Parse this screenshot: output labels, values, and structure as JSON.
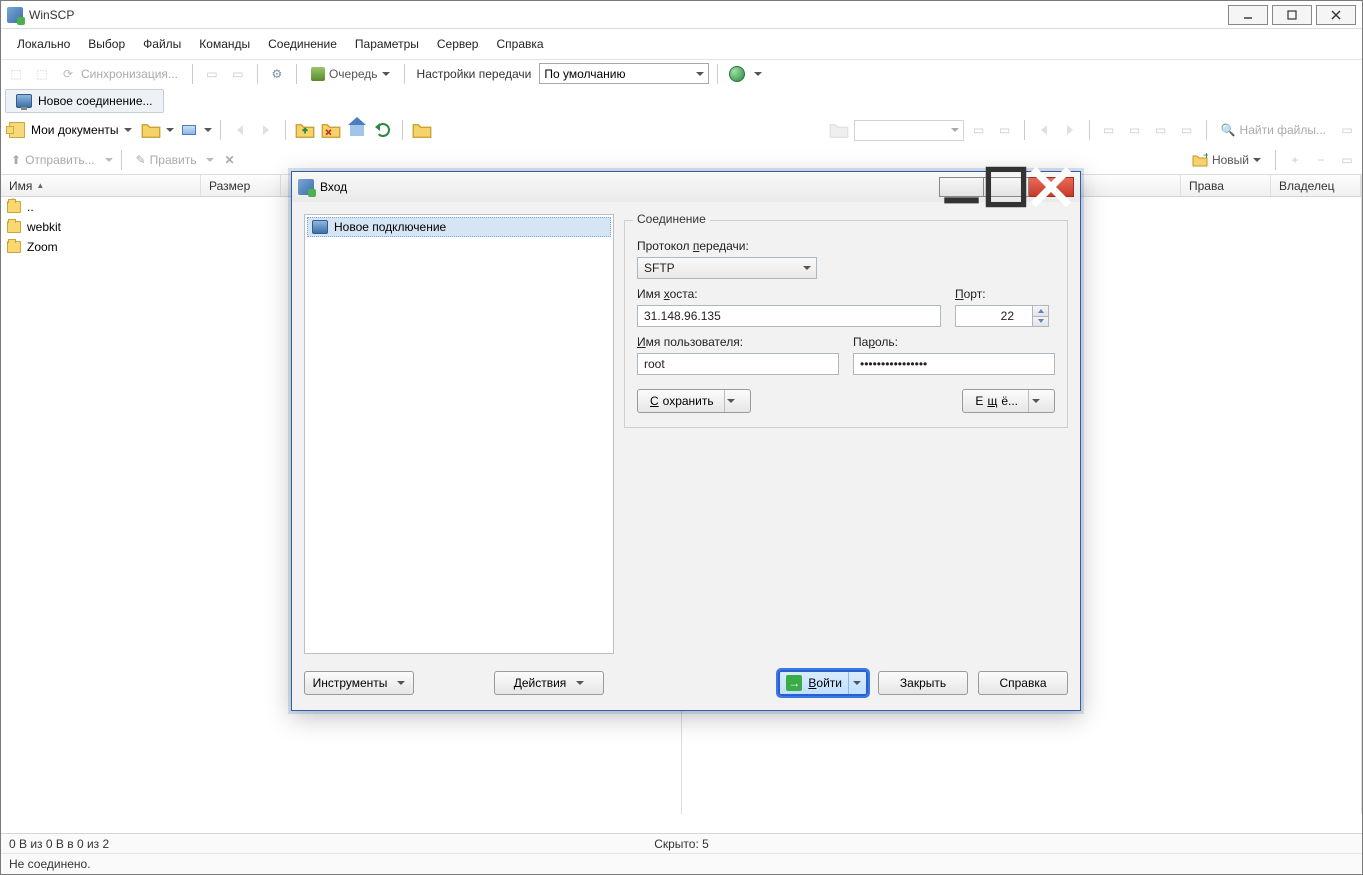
{
  "window": {
    "title": "WinSCP"
  },
  "menu": {
    "items": [
      "Локально",
      "Выбор",
      "Файлы",
      "Команды",
      "Соединение",
      "Параметры",
      "Сервер",
      "Справка"
    ]
  },
  "toolbar": {
    "sync": "Синхронизация...",
    "queue": "Очередь",
    "transfer_label": "Настройки передачи",
    "transfer_preset": "По умолчанию"
  },
  "tabs": {
    "new_connection": "Новое соединение..."
  },
  "nav": {
    "my_documents": "Мои документы",
    "find_files": "Найти файлы..."
  },
  "actions": {
    "send": "Отправить...",
    "edit": "Править",
    "new": "Новый"
  },
  "columns": {
    "left": [
      "Имя",
      "Размер"
    ],
    "right": [
      "Права",
      "Владелец"
    ]
  },
  "files": {
    "up": "..",
    "items": [
      "webkit",
      "Zoom"
    ]
  },
  "status": {
    "selection": "0 B из 0 B в 0 из 2",
    "hidden": "Скрыто: 5",
    "not_connected": "Не соединено."
  },
  "dialog": {
    "title": "Вход",
    "new_site": "Новое подключение",
    "group": "Соединение",
    "protocol_label_pre": "Протокол ",
    "protocol_label_ul": "п",
    "protocol_label_post": "ередачи:",
    "protocol_value": "SFTP",
    "host_label_pre": "Имя ",
    "host_label_ul": "х",
    "host_label_post": "оста:",
    "host_value": "31.148.96.135",
    "port_label_ul": "П",
    "port_label_post": "орт:",
    "port_value": "22",
    "user_label_ul": "И",
    "user_label_post": "мя пользователя:",
    "user_value": "root",
    "pass_label_pre": "Па",
    "pass_label_ul": "р",
    "pass_label_post": "оль:",
    "pass_value": "••••••••••••••••",
    "save_ul": "С",
    "save_post": "охранить",
    "more_pre": "Е",
    "more_ul": "щ",
    "more_post": "ё...",
    "tools": "Инструменты",
    "actions": "Действия",
    "login_ul": "В",
    "login_post": "ойти",
    "close": "Закрыть",
    "help": "Справка"
  }
}
